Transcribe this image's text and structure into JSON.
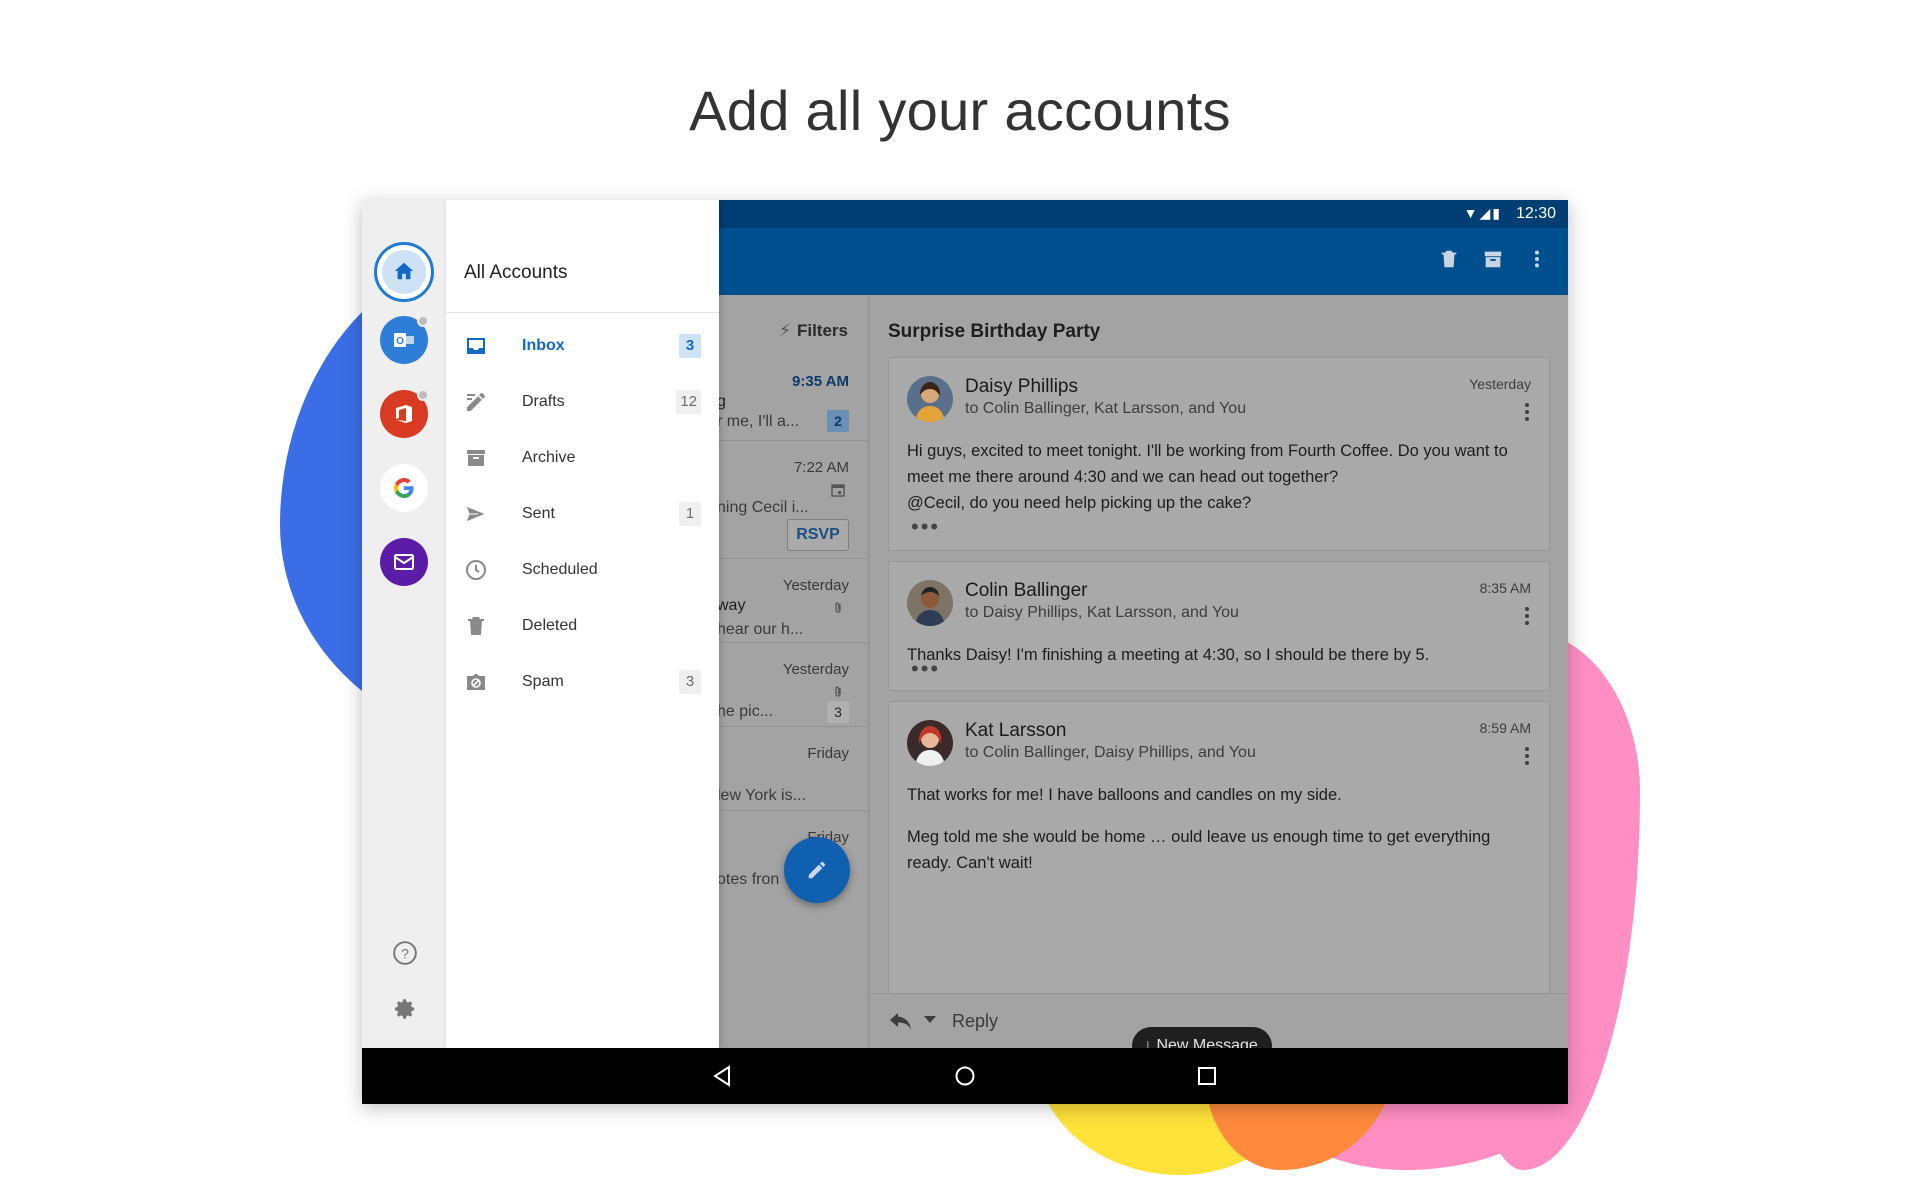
{
  "headline": "Add all your accounts",
  "status_bar": {
    "time": "12:30",
    "icons": [
      "wifi-icon",
      "signal-icon",
      "battery-icon"
    ]
  },
  "toolbar": {
    "actions": [
      "delete-icon",
      "archive-icon",
      "more-icon"
    ]
  },
  "colors": {
    "brand": "#00508f",
    "accent": "#1369c4",
    "status_bar": "#003e73",
    "fab": "#1060b0"
  },
  "account_rail": {
    "accounts": [
      "home-icon",
      "outlook-icon",
      "office-icon",
      "google-icon",
      "mail-icon"
    ],
    "footer": [
      "help-icon",
      "settings-icon"
    ]
  },
  "drawer": {
    "title": "All Accounts",
    "folders": [
      {
        "label": "Inbox",
        "count": "3",
        "icon": "inbox-icon"
      },
      {
        "label": "Drafts",
        "count": "12",
        "icon": "drafts-icon"
      },
      {
        "label": "Archive",
        "count": "",
        "icon": "archive-icon"
      },
      {
        "label": "Sent",
        "count": "1",
        "icon": "sent-icon"
      },
      {
        "label": "Scheduled",
        "count": "",
        "icon": "clock-icon"
      },
      {
        "label": "Deleted",
        "count": "",
        "icon": "trash-icon"
      },
      {
        "label": "Spam",
        "count": "3",
        "icon": "spam-icon"
      }
    ]
  },
  "message_list": {
    "filters_label": "Filters",
    "rows": [
      {
        "time": "9:35 AM",
        "subject": "g",
        "preview": "r me, I'll a...",
        "badge": "2"
      },
      {
        "time": "7:22 AM",
        "preview": "ning Cecil i...",
        "rsvp": "RSVP"
      },
      {
        "time": "Yesterday",
        "subject": "way",
        "preview": "hear our h..."
      },
      {
        "time": "Yesterday",
        "preview": "he pic...",
        "badge": "3"
      },
      {
        "time": "Friday",
        "preview": "lew York is..."
      },
      {
        "time": "Friday",
        "preview": "otes fron"
      }
    ]
  },
  "conversation": {
    "subject": "Surprise Birthday Party",
    "messages": [
      {
        "sender": "Daisy Phillips",
        "recipients": "to Colin Ballinger, Kat Larsson, and You",
        "time": "Yesterday",
        "body": [
          "Hi guys, excited to meet tonight. I'll be working from Fourth Coffee. Do you want to meet me there around 4:30 and we can head out together?",
          "@Cecil, do you need help picking up the cake?"
        ]
      },
      {
        "sender": "Colin Ballinger",
        "recipients": "to Daisy Phillips, Kat Larsson, and You",
        "time": "8:35 AM",
        "body": [
          "Thanks Daisy! I'm finishing a meeting at 4:30, so I should be there by 5."
        ]
      },
      {
        "sender": "Kat Larsson",
        "recipients": "to Colin Ballinger, Daisy Phillips, and You",
        "time": "8:59 AM",
        "body": [
          "That works for me! I have balloons and candles on my side.",
          "Meg told me she would be home … ould leave us enough time to get everything ready. Can't wait!"
        ]
      }
    ],
    "new_message_pill": "New Message",
    "reply_label": "Reply"
  }
}
